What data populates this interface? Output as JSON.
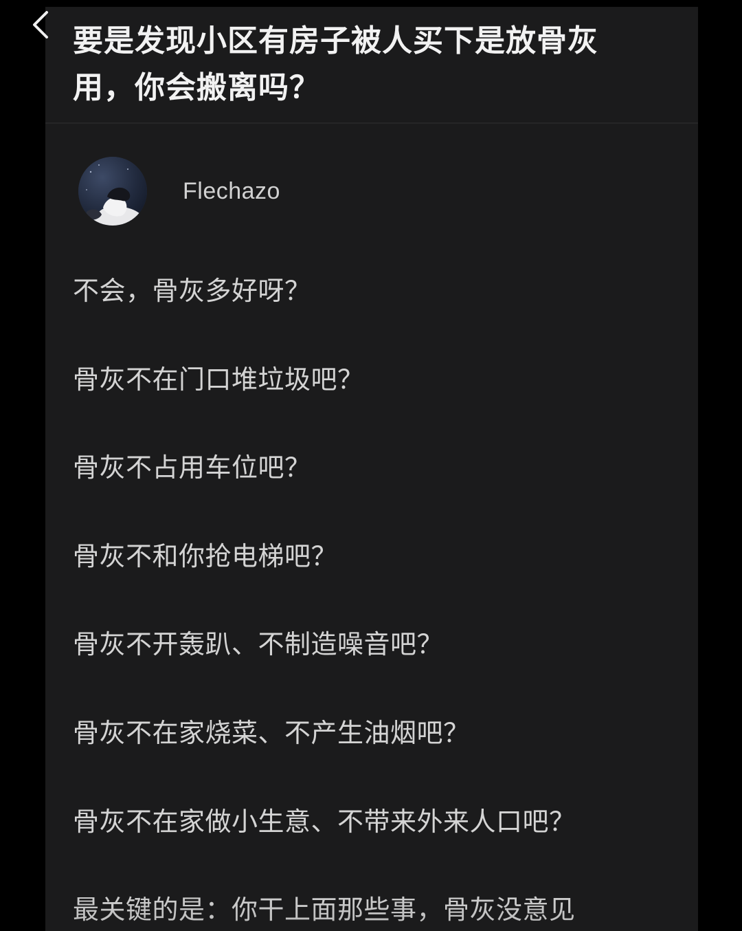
{
  "header": {
    "back_icon": "chevron-left-icon",
    "question_title": "要是发现小区有房子被人买下是放骨灰用，你会搬离吗？"
  },
  "author": {
    "name": "Flechazo",
    "avatar_icon": "avatar"
  },
  "answer": {
    "lines": [
      "不会，骨灰多好呀？",
      "骨灰不在门口堆垃圾吧？",
      "骨灰不占用车位吧？",
      "骨灰不和你抢电梯吧？",
      "骨灰不开轰趴、不制造噪音吧？",
      "骨灰不在家烧菜、不产生油烟吧？",
      "骨灰不在家做小生意、不带来外来人口吧？",
      "最关键的是：你干上面那些事，骨灰没意见"
    ]
  },
  "colors": {
    "page_background": "#000000",
    "card_background": "#1b1b1c",
    "title_text": "#f2f2f2",
    "body_text": "#d4d4d4"
  }
}
